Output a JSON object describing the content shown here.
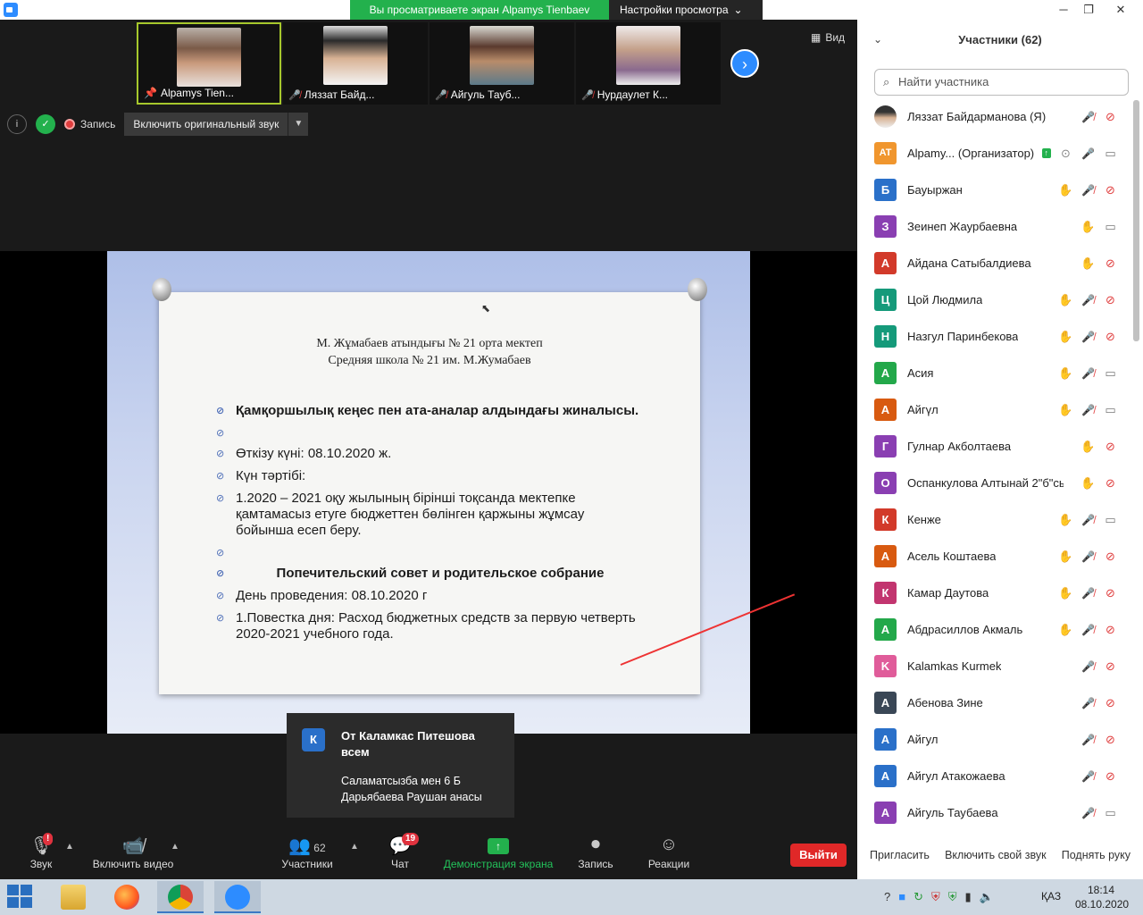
{
  "titlebar": {
    "share_notice": "Вы просматриваете экран Alpamys Tienbaev",
    "view_settings": "Настройки просмотра"
  },
  "gallery": {
    "thumbs": [
      {
        "name": "Alpamys Tien...",
        "muted": false,
        "pinned": true
      },
      {
        "name": "Ляззат Байд...",
        "muted": true
      },
      {
        "name": "Айгуль Тауб...",
        "muted": true
      },
      {
        "name": "Нурдаулет К...",
        "muted": true
      }
    ],
    "view_label": "Вид"
  },
  "status": {
    "record_label": "Запись",
    "original_sound": "Включить оригинальный звук"
  },
  "slide": {
    "school_kz": "М. Жұмабаев атындығы № 21 орта мектеп",
    "school_ru": "Средняя школа № 21 им. М.Жумабаев",
    "bullets": [
      "Қамқоршылық кеңес пен ата-аналар алдындағы жиналысы.",
      "",
      "Өткізу күні: 08.10.2020 ж.",
      "Күн тәртібі:",
      "1.2020 – 2021 оқу жылының бірінші тоқсанда мектепке қамтамасыз етуге бюджеттен бөлінген қаржыны жұмсау бойынша есеп беру.",
      "",
      "Попечительский совет и родительское собрание",
      "День проведения: 08.10.2020 г",
      "1.Повестка дня: Расход бюджетных средств за первую четверть 2020-2021 учебного года."
    ]
  },
  "chat_notification": {
    "avatar": "К",
    "from": "От Каламкас Питешова всем",
    "message": "Саламатсызба мен 6 Б Дарьябаева Раушан анасы"
  },
  "toolbar": {
    "audio": "Звук",
    "video": "Включить видео",
    "participants": "Участники",
    "participants_count": "62",
    "chat": "Чат",
    "chat_badge": "19",
    "share": "Демонстрация экрана",
    "record": "Запись",
    "reactions": "Реакции",
    "leave": "Выйти"
  },
  "panel": {
    "title": "Участники (62)",
    "search_placeholder": "Найти участника",
    "participants": [
      {
        "name": "Ляззат Байдарманова (Я)",
        "initials": "",
        "color": "#c9a27e",
        "hand": false,
        "muted": true,
        "video": false,
        "photo": true
      },
      {
        "name": "Alpamy... (Организатор)",
        "initials": "AT",
        "color": "#f0962e",
        "hand": false,
        "muted": false,
        "video": true,
        "host": true
      },
      {
        "name": "Бауыржан",
        "initials": "Б",
        "color": "#2a70c9",
        "hand": true,
        "muted": true,
        "video": false
      },
      {
        "name": "Зеинеп Жаурбаевна",
        "initials": "З",
        "color": "#8a3fb2",
        "hand": true,
        "muted": false,
        "video": true,
        "nomic": true
      },
      {
        "name": "Айдана Сатыбалдиева",
        "initials": "А",
        "color": "#d23a2a",
        "hand": true,
        "muted": false,
        "video": false,
        "nomic": true
      },
      {
        "name": "Цой Людмила",
        "initials": "Ц",
        "color": "#159a7a",
        "hand": true,
        "muted": true,
        "video": false
      },
      {
        "name": "Назгул Паринбекова",
        "initials": "Н",
        "color": "#159a7a",
        "hand": true,
        "muted": true,
        "video": false
      },
      {
        "name": "Асия",
        "initials": "А",
        "color": "#23a84a",
        "hand": true,
        "muted": true,
        "video": true
      },
      {
        "name": "Айгүл",
        "initials": "А",
        "color": "#d85a10",
        "hand": true,
        "muted": true,
        "video": true
      },
      {
        "name": "Гулнар Акболтаева",
        "initials": "Г",
        "color": "#8a3fb2",
        "hand": true,
        "muted": false,
        "video": false,
        "nomic": true
      },
      {
        "name": "Оспанкулова Алтынай 2\"б\"сы...",
        "initials": "О",
        "color": "#8a3fb2",
        "hand": true,
        "muted": false,
        "video": false,
        "nomic": true
      },
      {
        "name": "Кенже",
        "initials": "К",
        "color": "#d23a2a",
        "hand": true,
        "muted": true,
        "video": true
      },
      {
        "name": "Асель Коштаева",
        "initials": "А",
        "color": "#d85a10",
        "hand": true,
        "muted": true,
        "video": false
      },
      {
        "name": "Камар Даутова",
        "initials": "К",
        "color": "#c2356f",
        "hand": true,
        "muted": true,
        "video": false
      },
      {
        "name": "Абдрасиллов Акмаль",
        "initials": "А",
        "color": "#23a84a",
        "hand": true,
        "muted": true,
        "video": false
      },
      {
        "name": "Kalamkas Kurmek",
        "initials": "K",
        "color": "#e05c9a",
        "hand": false,
        "muted": true,
        "video": false
      },
      {
        "name": "Абенова Зине",
        "initials": "А",
        "color": "#3a4756",
        "hand": false,
        "muted": true,
        "video": false
      },
      {
        "name": "Айгул",
        "initials": "А",
        "color": "#2a70c9",
        "hand": false,
        "muted": true,
        "video": false
      },
      {
        "name": "Айгул Атакожаева",
        "initials": "А",
        "color": "#2a70c9",
        "hand": false,
        "muted": true,
        "video": false
      },
      {
        "name": "Айгуль Таубаева",
        "initials": "А",
        "color": "#8a3fb2",
        "hand": false,
        "muted": true,
        "video": true
      }
    ],
    "invite": "Пригласить",
    "unmute_self": "Включить свой звук",
    "raise_hand": "Поднять руку"
  },
  "taskbar": {
    "lang": "ҚАЗ",
    "time": "18:14",
    "date": "08.10.2020"
  }
}
